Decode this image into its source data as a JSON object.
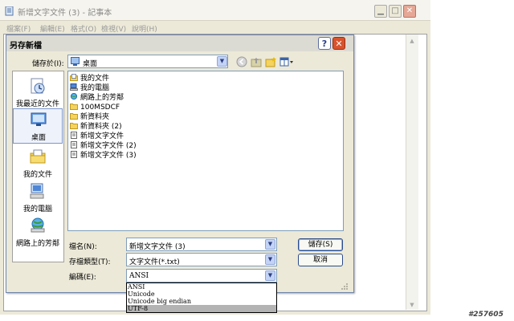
{
  "notepad": {
    "title": "新增文字文件 (3) - 記事本",
    "controls": {
      "minimize": "▁",
      "maximize": "□",
      "close": "✕"
    },
    "menu": [
      "檔案(F)",
      "編輯(E)",
      "格式(O)",
      "檢視(V)",
      "說明(H)"
    ]
  },
  "dialog": {
    "title": "另存新檔",
    "help": "?",
    "close": "✕",
    "save_in_label": "儲存於(I):",
    "save_in_value": "桌面",
    "places": [
      "我最近的文件",
      "桌面",
      "我的文件",
      "我的電腦",
      "網路上的芳鄰"
    ],
    "files": [
      {
        "name": "我的文件",
        "icon": "folder-docs"
      },
      {
        "name": "我的電腦",
        "icon": "computer"
      },
      {
        "name": "網路上的芳鄰",
        "icon": "network"
      },
      {
        "name": "100MSDCF",
        "icon": "folder"
      },
      {
        "name": "新資料夾",
        "icon": "folder"
      },
      {
        "name": "新資料夾 (2)",
        "icon": "folder"
      },
      {
        "name": "新增文字文件",
        "icon": "text-file"
      },
      {
        "name": "新增文字文件 (2)",
        "icon": "text-file"
      },
      {
        "name": "新增文字文件 (3)",
        "icon": "text-file"
      }
    ],
    "filename_label": "檔名(N):",
    "filename_value": "新增文字文件 (3)",
    "filetype_label": "存檔類型(T):",
    "filetype_value": "文字文件(*.txt)",
    "encoding_label": "編碼(E):",
    "encoding_value": "ANSI",
    "encoding_options": [
      "ANSI",
      "Unicode",
      "Unicode big endian",
      "UTF-8"
    ],
    "encoding_highlighted": "UTF-8",
    "save_button": "儲存(S)",
    "cancel_button": "取消"
  },
  "watermark": "#257605",
  "colors": {
    "dialog_border": "#6f87b0",
    "close_red": "#d8532e",
    "combo_border": "#7f9db9",
    "highlight": "#b3b3b3"
  }
}
